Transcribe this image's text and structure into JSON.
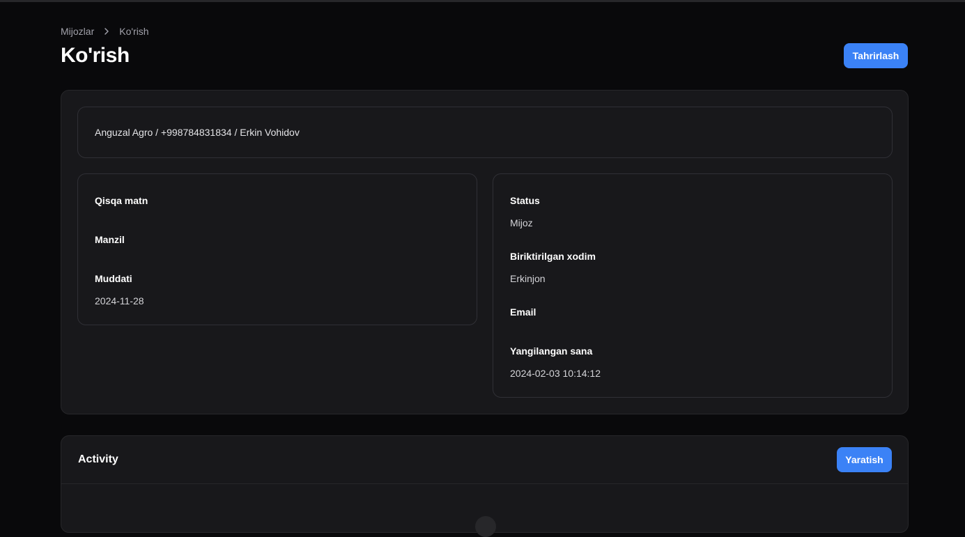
{
  "breadcrumb": {
    "items": [
      "Mijozlar",
      "Ko'rish"
    ]
  },
  "page": {
    "title": "Ko'rish",
    "edit_button": "Tahrirlash"
  },
  "summary": {
    "text": "Anguzal Agro / +998784831834 / Erkin Vohidov"
  },
  "left_panel": {
    "fields": [
      {
        "label": "Qisqa matn",
        "value": ""
      },
      {
        "label": "Manzil",
        "value": ""
      },
      {
        "label": "Muddati",
        "value": "2024-11-28"
      }
    ]
  },
  "right_panel": {
    "fields": [
      {
        "label": "Status",
        "value": "Mijoz"
      },
      {
        "label": "Biriktirilgan xodim",
        "value": "Erkinjon"
      },
      {
        "label": "Email",
        "value": ""
      },
      {
        "label": "Yangilangan sana",
        "value": "2024-02-03 10:14:12"
      }
    ]
  },
  "activity": {
    "title": "Activity",
    "create_button": "Yaratish"
  },
  "colors": {
    "accent": "#3b82f6",
    "background": "#09090b",
    "card": "#18181b",
    "border": "#27272a"
  },
  "icons": {
    "breadcrumb_separator": "chevron-right-icon"
  }
}
